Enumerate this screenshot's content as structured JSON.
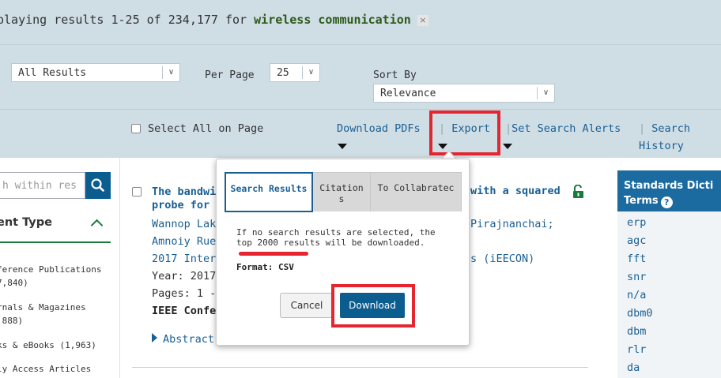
{
  "header": {
    "results_prefix": "playing results 1-25 of 234,177 for ",
    "query": "wireless communication",
    "clear_icon": "×"
  },
  "filters": {
    "scope_value": "All Results",
    "per_page_label": "Per Page",
    "per_page_value": "25",
    "sort_by_label": "Sort By",
    "sort_value": "Relevance",
    "caret": "∨"
  },
  "actions": {
    "select_all_label": "Select All on Page",
    "download_pdfs": "Download PDFs",
    "export": "Export",
    "set_alerts": "Set Search Alerts",
    "search_history_1": "Search",
    "search_history_2": "History",
    "separator": "|"
  },
  "sidebar": {
    "search_placeholder": "h within res",
    "content_type_header": "ent Type",
    "facets": [
      {
        "line1": "ference Publications",
        "line2": "7,840)"
      },
      {
        "line1": "rnals & Magazines",
        "line2": ",888)"
      },
      {
        "line1": "ks & eBooks (1,963)",
        "line2": ""
      },
      {
        "line1": "ly Access Articles",
        "line2": ""
      }
    ]
  },
  "result": {
    "title_part1": "The bandwi",
    "title_part2": "probe for ",
    "title_right": "with a squared",
    "authors_line1_left": "Wannop Lak",
    "authors_line1_right": "Pirajnanchai;",
    "authors_line2": "Amnoiy Rue",
    "conference_left": "2017 Inter",
    "conference_right": "s (iEECON)",
    "year": "Year: 2017",
    "pages": "Pages: 1 -",
    "publisher": "IEEE Confe",
    "abstract_label": "Abstract"
  },
  "standards": {
    "header_line1": "Standards Dicti",
    "header_line2": "Terms",
    "help": "?",
    "terms": [
      "erp",
      "agc",
      "fft",
      "snr",
      "n/a",
      "dbm0",
      "dbm",
      "rlr",
      "da"
    ]
  },
  "popup": {
    "tabs": [
      {
        "label_line1": "Search Results",
        "label_line2": ""
      },
      {
        "label_line1": "Citation",
        "label_line2": "s"
      },
      {
        "label_line1": "To Collabratec",
        "label_line2": ""
      }
    ],
    "message_line1": "If no search results are selected, the",
    "message_line2": "top 2000 results will be downloaded.",
    "format": "Format: CSV",
    "cancel_label": "Cancel",
    "download_label": "Download"
  },
  "colors": {
    "accent_blue": "#1a5f94",
    "button_blue": "#0c5d8f",
    "highlight_red": "#e52631",
    "banner_bg": "#cfdde5",
    "query_green": "#2f5a1a"
  }
}
